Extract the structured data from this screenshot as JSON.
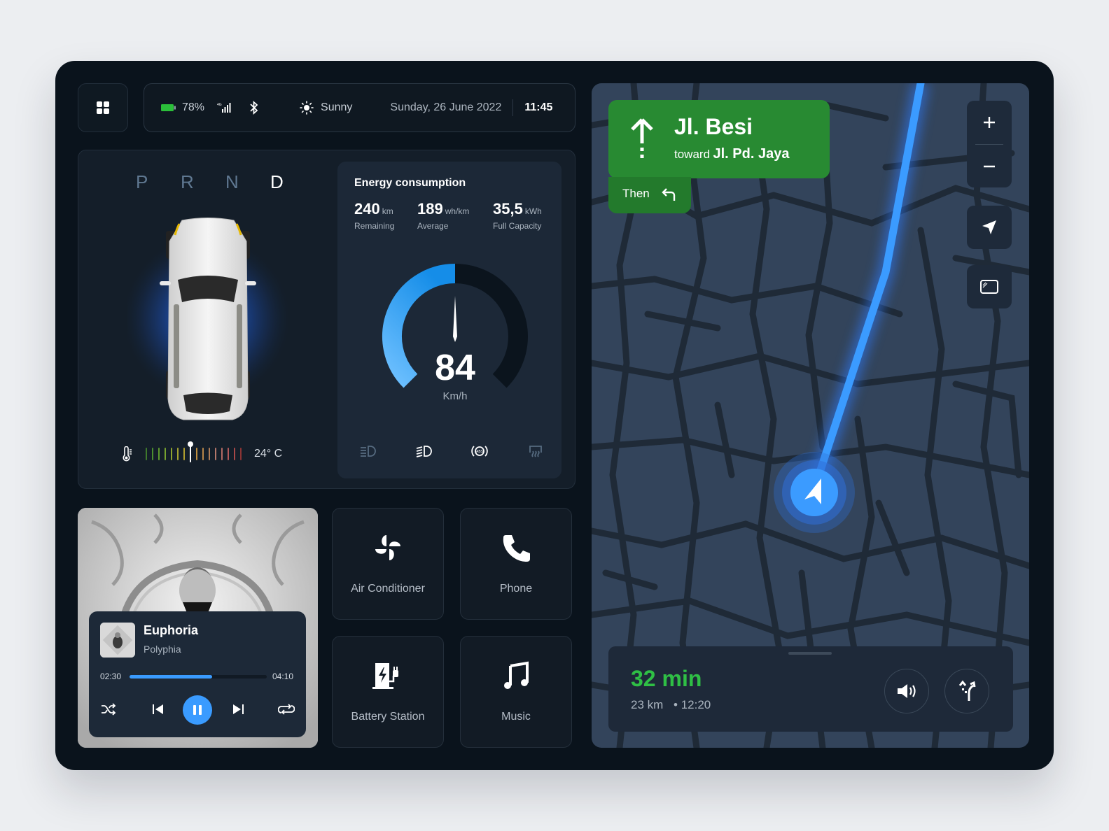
{
  "statusbar": {
    "menu_icon": "grid-icon",
    "battery_percent": "78%",
    "battery_color": "#2bbf3a",
    "signal_label": "4G",
    "weather": "Sunny",
    "date": "Sunday, 26 June 2022",
    "time": "11:45"
  },
  "drive": {
    "gears": [
      "P",
      "R",
      "N",
      "D"
    ],
    "active_gear": "D",
    "temperature": "24° C",
    "temperature_level_fraction": 0.47
  },
  "energy": {
    "title": "Energy consumption",
    "stats": [
      {
        "value": "240",
        "unit": "km",
        "label": "Remaining"
      },
      {
        "value": "189",
        "unit": "wh/km",
        "label": "Average"
      },
      {
        "value": "35,5",
        "unit": "kWh",
        "label": "Full Capacity"
      }
    ],
    "speed": "84",
    "speed_unit": "Km/h",
    "speed_fraction": 0.5,
    "indicators": [
      {
        "name": "low-beam-icon",
        "active": false
      },
      {
        "name": "high-beam-icon",
        "active": true
      },
      {
        "name": "abs-icon",
        "active": true
      },
      {
        "name": "rear-defrost-icon",
        "active": false
      }
    ]
  },
  "music": {
    "title": "Euphoria",
    "artist": "Polyphia",
    "elapsed": "02:30",
    "duration": "04:10",
    "progress_fraction": 0.6
  },
  "tiles": [
    {
      "label": "Air Conditioner",
      "icon": "fan-icon"
    },
    {
      "label": "Phone",
      "icon": "phone-icon"
    },
    {
      "label": "Battery Station",
      "icon": "charging-station-icon"
    },
    {
      "label": "Music",
      "icon": "music-note-icon"
    }
  ],
  "navigation": {
    "street": "Jl. Besi",
    "toward_prefix": "toward",
    "toward_street": "Jl. Pd. Jaya",
    "then_label": "Then",
    "eta_minutes": "32 min",
    "distance": "23 km",
    "arrival": "• 12:20",
    "accent_green": "#2fbf45",
    "route_blue": "#3b9bff"
  }
}
